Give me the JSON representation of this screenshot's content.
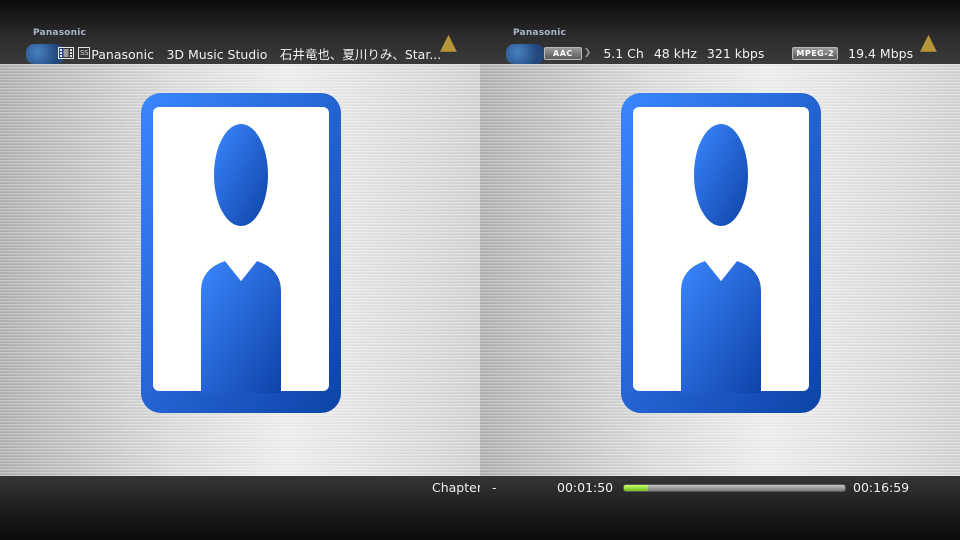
{
  "osd_left": {
    "brand": "Panasonic",
    "title": "Panasonic　3D Music Studio　石井竜也、夏川りみ、Star..."
  },
  "osd_right": {
    "brand": "Panasonic",
    "audio_codec": "AAC",
    "channels": "5.1 Ch",
    "sample_rate": "48 kHz",
    "audio_bitrate": "321 kbps",
    "video_codec": "MPEG-2",
    "video_bitrate": "19.4 Mbps"
  },
  "playback": {
    "chapter_label": "Chapter",
    "chapter_value": "-",
    "elapsed": "00:01:50",
    "total": "00:16:59",
    "progress_fraction": 0.108
  },
  "icons": {
    "film": "film-icon",
    "ss": "ss-badge-icon",
    "frame": "person-frame-icon"
  },
  "colors": {
    "frame_blue": "#1f63c9",
    "progress_green": "#8ee23a"
  }
}
